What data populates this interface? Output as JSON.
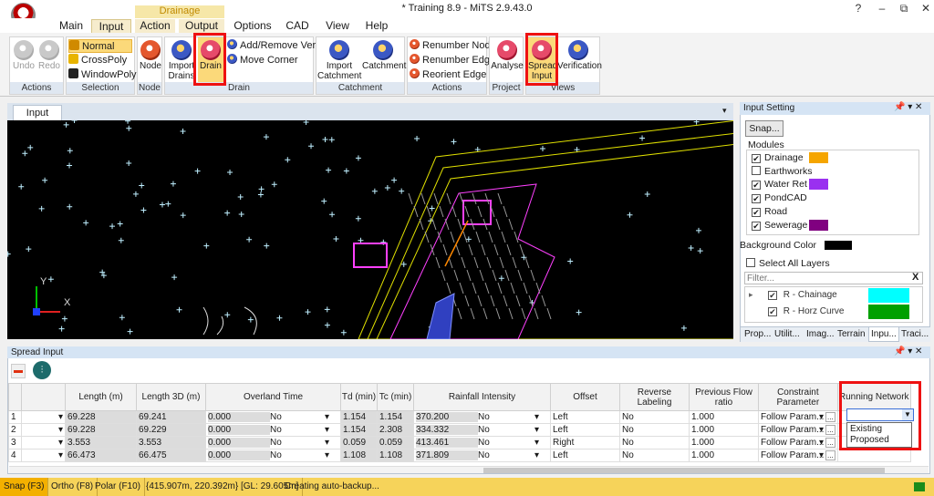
{
  "window": {
    "title": "* Training 8.9 - MiTS 2.9.43.0",
    "context_label": "Drainage",
    "controls": [
      "?",
      "–",
      "⧉",
      "✕"
    ]
  },
  "menu_tabs": [
    "Main",
    "Input",
    "Action",
    "Output",
    "Options",
    "CAD",
    "View",
    "Help"
  ],
  "ribbon": {
    "groups": [
      {
        "label": "Actions"
      },
      {
        "label": "Selection"
      },
      {
        "label": "Node"
      },
      {
        "label": "Drain"
      },
      {
        "label": "Catchment"
      },
      {
        "label": "Actions"
      },
      {
        "label": "Project"
      },
      {
        "label": "Views"
      }
    ],
    "undo": "Undo",
    "redo": "Redo",
    "normal": "Normal",
    "crosspoly": "CrossPoly",
    "windowpoly": "WindowPoly",
    "node": "Node",
    "import_drains": "Import Drains",
    "drain": "Drain",
    "add_remove_vertex": "Add/Remove Vertex",
    "move_corner": "Move Corner",
    "import_catchment": "Import Catchment",
    "catchment": "Catchment",
    "renumber_node": "Renumber Node",
    "renumber_edge": "Renumber Edge",
    "reorient_edge": "Reorient Edge",
    "analyse": "Analyse",
    "spread_input": "Spread Input",
    "verification": "Verification"
  },
  "doc_tab": "Input",
  "axis": {
    "y": "Y",
    "x": "X"
  },
  "input_setting": {
    "title": "Input Setting",
    "snap": "Snap...",
    "modules_label": "Modules",
    "modules": [
      {
        "name": "Drainage",
        "checked": true,
        "color": "#f5a500"
      },
      {
        "name": "Earthworks",
        "checked": false,
        "color": ""
      },
      {
        "name": "Water Ret",
        "checked": true,
        "color": "#9a30f0"
      },
      {
        "name": "PondCAD",
        "checked": true,
        "color": ""
      },
      {
        "name": "Road",
        "checked": true,
        "color": ""
      },
      {
        "name": "Sewerage",
        "checked": true,
        "color": "#800080"
      }
    ],
    "bg_label": "Background Color",
    "bg_color": "#000000",
    "select_all": "Select All Layers",
    "filter_placeholder": "Filter...",
    "filter_clear": "X",
    "layers": [
      {
        "name": "R - Chainage",
        "color": "#00ffff"
      },
      {
        "name": "R - Horz Curve",
        "color": "#00a000"
      }
    ],
    "tabs": [
      "Prop...",
      "Utilit...",
      "Imag...",
      "Terrain",
      "Inpu...",
      "Traci..."
    ]
  },
  "spread": {
    "title": "Spread Input",
    "columns": [
      "",
      "",
      "Length (m)",
      "Length 3D (m)",
      "Overland Time",
      "Td (min)",
      "Tc (min)",
      "Rainfall Intensity",
      "Offset",
      "Reverse Labeling",
      "Previous Flow ratio",
      "Constraint Parameter",
      "Running Network"
    ],
    "rows": [
      {
        "n": "1",
        "len": "69.228",
        "len3d": "69.241",
        "ot": "0.000",
        "otc": "No",
        "td": "1.154",
        "tc": "1.154",
        "ri": "370.200",
        "ric": "No",
        "off": "Left",
        "rev": "No",
        "pfr": "1.000",
        "cp": "Follow  Param..."
      },
      {
        "n": "2",
        "len": "69.228",
        "len3d": "69.229",
        "ot": "0.000",
        "otc": "No",
        "td": "1.154",
        "tc": "2.308",
        "ri": "334.332",
        "ric": "No",
        "off": "Left",
        "rev": "No",
        "pfr": "1.000",
        "cp": "Follow  Param..."
      },
      {
        "n": "3",
        "len": "3.553",
        "len3d": "3.553",
        "ot": "0.000",
        "otc": "No",
        "td": "0.059",
        "tc": "0.059",
        "ri": "413.461",
        "ric": "No",
        "off": "Right",
        "rev": "No",
        "pfr": "1.000",
        "cp": "Follow  Param..."
      },
      {
        "n": "4",
        "len": "66.473",
        "len3d": "66.475",
        "ot": "0.000",
        "otc": "No",
        "td": "1.108",
        "tc": "1.108",
        "ri": "371.809",
        "ric": "No",
        "off": "Left",
        "rev": "No",
        "pfr": "1.000",
        "cp": "Follow  Param..."
      }
    ],
    "ellipsis": "..."
  },
  "network_dropdown": {
    "options": [
      "Existing",
      "Proposed"
    ]
  },
  "statusbar": {
    "snap": "Snap (F3)",
    "ortho": "Ortho (F8)",
    "polar": "Polar (F10)",
    "coords": "{415.907m, 220.392m} [GL: 29.605m]",
    "message": "Creating auto-backup..."
  }
}
